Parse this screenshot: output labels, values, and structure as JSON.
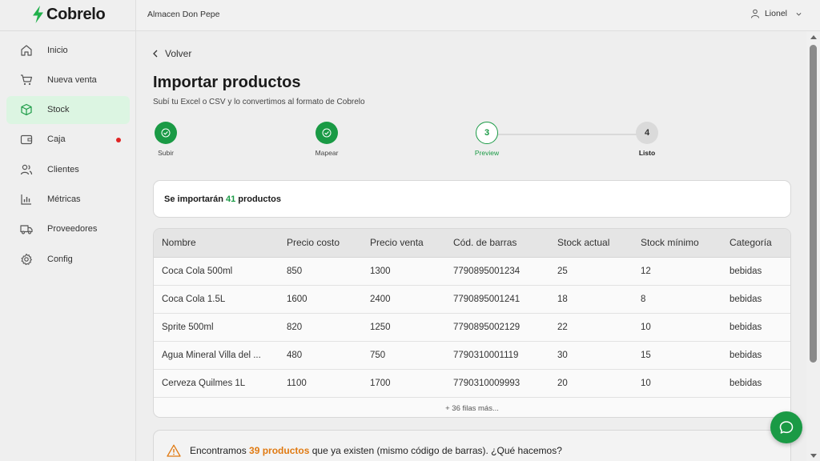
{
  "brand": {
    "name": "Cobrelo",
    "accent": "#1a9a45"
  },
  "topbar": {
    "store": "Almacen Don Pepe",
    "user": "Lionel"
  },
  "sidebar": {
    "items": [
      {
        "label": "Inicio",
        "icon": "home-icon"
      },
      {
        "label": "Nueva venta",
        "icon": "cart-icon"
      },
      {
        "label": "Stock",
        "icon": "box-icon",
        "active": true
      },
      {
        "label": "Caja",
        "icon": "wallet-icon",
        "badge": true
      },
      {
        "label": "Clientes",
        "icon": "users-icon"
      },
      {
        "label": "Métricas",
        "icon": "chart-icon"
      },
      {
        "label": "Proveedores",
        "icon": "truck-icon"
      },
      {
        "label": "Config",
        "icon": "gear-icon"
      }
    ]
  },
  "page": {
    "back_label": "Volver",
    "title": "Importar productos",
    "subtitle": "Subí tu Excel o CSV y lo convertimos al formato de Cobrelo"
  },
  "stepper": {
    "steps": [
      {
        "number": "1",
        "label": "Subir",
        "state": "done"
      },
      {
        "number": "2",
        "label": "Mapear",
        "state": "done"
      },
      {
        "number": "3",
        "label": "Preview",
        "state": "current"
      },
      {
        "number": "4",
        "label": "Listo",
        "state": "todo"
      }
    ]
  },
  "summary": {
    "prefix": "Se importarán",
    "count": "41",
    "suffix": "productos"
  },
  "table": {
    "columns": [
      "Nombre",
      "Precio costo",
      "Precio venta",
      "Cód. de barras",
      "Stock actual",
      "Stock mínimo",
      "Categoría"
    ],
    "rows": [
      [
        "Coca Cola 500ml",
        "850",
        "1300",
        "7790895001234",
        "25",
        "12",
        "bebidas"
      ],
      [
        "Coca Cola 1.5L",
        "1600",
        "2400",
        "7790895001241",
        "18",
        "8",
        "bebidas"
      ],
      [
        "Sprite 500ml",
        "820",
        "1250",
        "7790895002129",
        "22",
        "10",
        "bebidas"
      ],
      [
        "Agua Mineral Villa del ...",
        "480",
        "750",
        "7790310001119",
        "30",
        "15",
        "bebidas"
      ],
      [
        "Cerveza Quilmes 1L",
        "1100",
        "1700",
        "7790310009993",
        "20",
        "10",
        "bebidas"
      ]
    ],
    "more_rows": "+ 36 filas más..."
  },
  "warning": {
    "prefix": "Encontramos",
    "highlight": "39 productos",
    "suffix": "que ya existen (mismo código de barras). ¿Qué hacemos?",
    "color": "#e07a12"
  }
}
